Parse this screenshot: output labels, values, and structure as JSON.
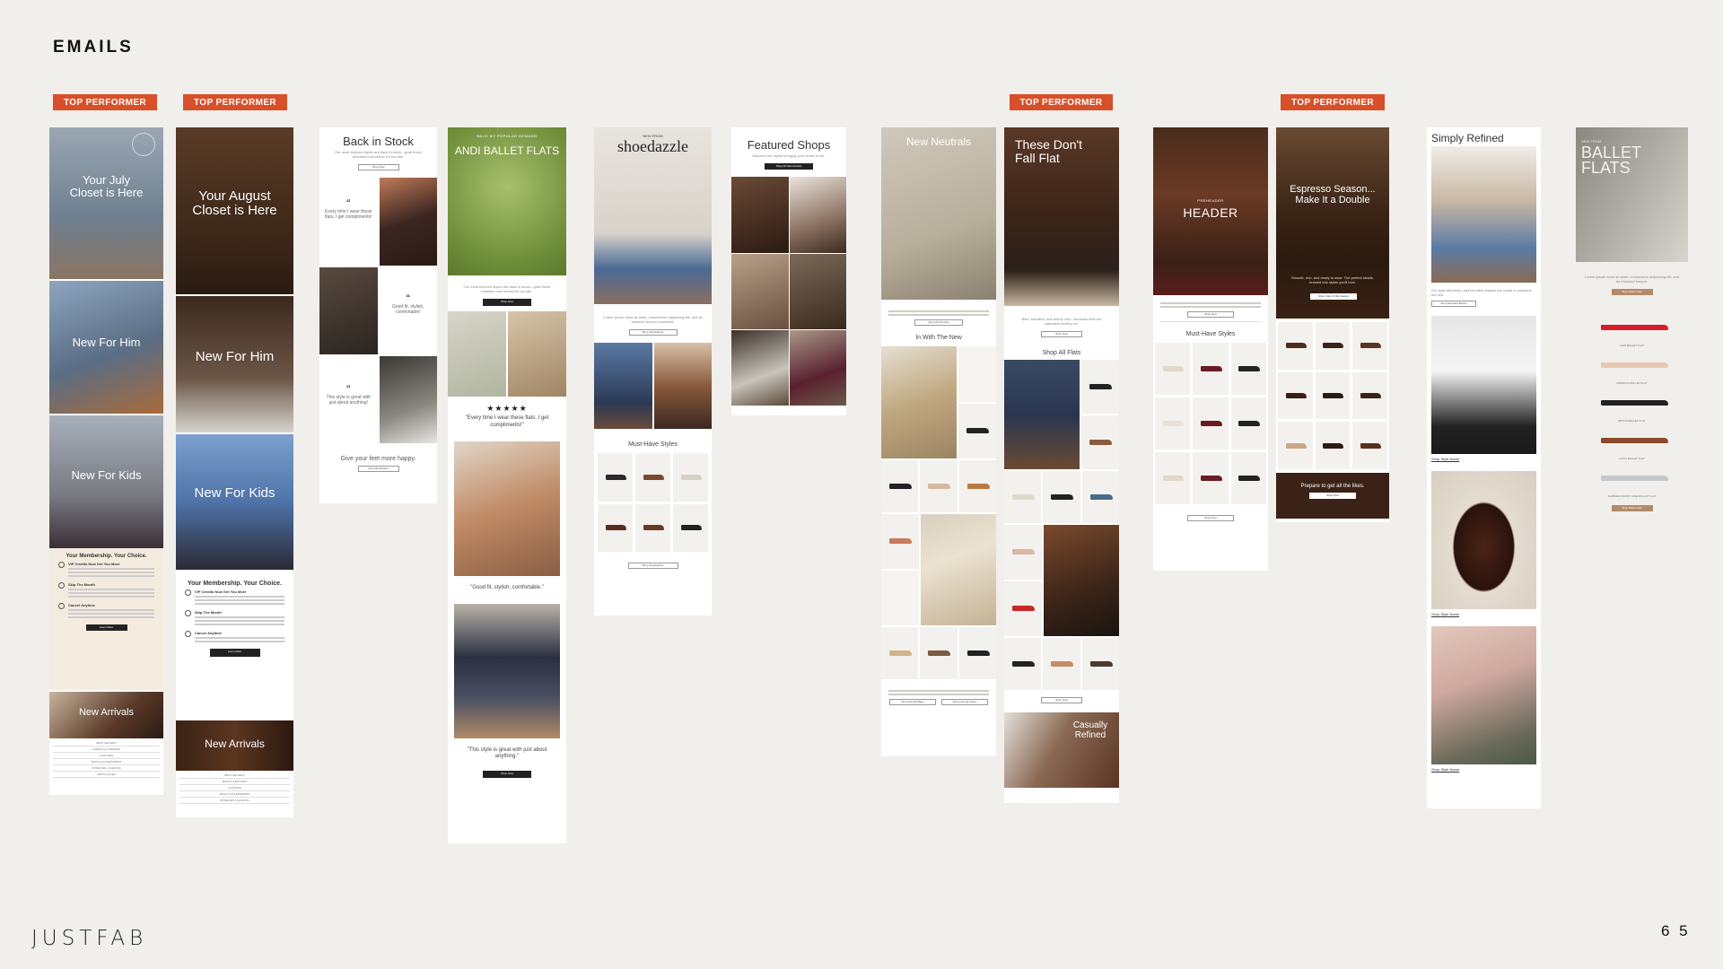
{
  "page": {
    "title": "EMAILS",
    "brand": "JUSTFAB",
    "page_number": "6 5"
  },
  "badges": {
    "label": "TOP PERFORMER"
  },
  "email1": {
    "hero_title": "Your July\nCloset is Here",
    "him": "New For Him",
    "kids": "New For Kids",
    "membership_title": "Your Membership. Your Choice.",
    "steps": [
      "VIP Credits Now Get You More",
      "Skip The Month",
      "Cancel Anytime"
    ],
    "cta": "Learn More",
    "arrivals": "New Arrivals",
    "links": [
      "BEST SELLERS",
      "SANDALS & WEDGES",
      "CLOTHING",
      "BAGS & ACCESSORIES",
      "INTIMATES + SHAPING",
      "MEN'S SHOES"
    ]
  },
  "email2": {
    "hero_title": "Your August\nCloset is Here",
    "him": "New For Him",
    "kids": "New For Kids",
    "membership_title": "Your Membership. Your Choice.",
    "steps": [
      "VIP Credits Now Get You More",
      "Skip The Month",
      "Cancel Anytime"
    ],
    "cta": "Learn More",
    "arrivals": "New Arrivals",
    "links": [
      "BEST SELLERS",
      "BOOTS & BOOTIES",
      "CLOTHING",
      "BAGS & ACCESSORIES",
      "INTIMATES & SHAPING"
    ]
  },
  "email3": {
    "title": "Back in Stock",
    "subtitle": "Our most beloved styles are back in stock—grab these beauties now before it's too late.",
    "cta": "Shop Now",
    "quote1": "Every time I wear these flats, I get compliments!",
    "quote2": "Good fit, stylish, comfortable!",
    "quote3": "This style is great with just about anything!",
    "footer": "Give your feet more happy.",
    "footer_cta": "Shop Bestsellers"
  },
  "email4": {
    "eyebrow": "BACK BY POPULAR DEMAND",
    "title": "ANDI BALLET FLATS",
    "body": "Our most beloved styles are back in stock—grab these beauties now before it's too late.",
    "cta": "Shop Now",
    "stars": "★★★★★",
    "review1": "\"Every time I wear these flats, I get compliments!\"",
    "review2": "\"Good fit, stylish, comfortable.\"",
    "review3": "\"This style is great with just about anything.\""
  },
  "email5": {
    "eyebrow": "NEW FROM",
    "brand": "shoedazzle",
    "body": "Lorem ipsum dolor sit amet, consectetur adipiscing elit, sed do eiusmod tempor incididunt.",
    "cta": "Shop ShoeDazzle",
    "section": "Must-Have Styles"
  },
  "email6": {
    "title": "Featured Shops",
    "subtitle": "Discover the styles bringing your closet to life.",
    "cta": "Shop All New Arrivals"
  },
  "email7": {
    "title": "New Neutrals",
    "cta": "Shop All Neutrals",
    "section": "In With The New",
    "cta2": "Shop Neutral Bags",
    "cta3": "Shop Neutral Shoes"
  },
  "email8": {
    "title": "These Don't\nFall Flat",
    "body": "Bold, elevated, and utterly chic—because flats are statement-worthy too.",
    "cta": "Shop Now",
    "section": "Shop All Flats",
    "cta2": "Shop Now",
    "footer_title": "Casually\nRefined"
  },
  "email9": {
    "eyebrow": "PREHEADER",
    "title": "HEADER",
    "cta": "Shop Now",
    "section": "Must-Have Styles",
    "cta2": "Shop Now"
  },
  "email10": {
    "title": "Espresso Season...\nMake It a Double",
    "body": "Smooth, rich, and ready to wear. The perfect shade, brewed into styles you'll love.",
    "cta": "Shop Color of the Season",
    "banner": "Prepare to get all the likes.",
    "banner_cta": "Shop Now"
  },
  "email11": {
    "title": "Simply Refined",
    "body": "Our light affections, and elevated staples are made to sunshine the rest.",
    "cta": "Shop Elevated Basics",
    "links": [
      "Shop Style Name",
      "Shop Style Name",
      "Shop Style Name"
    ]
  },
  "email12": {
    "eyebrow": "NEW FROM",
    "title": "BALLET\nFLATS",
    "body": "Lorem ipsum dolor sit amet, consectetur adipiscing elit, sed do eiusmod tempor.",
    "cta": "Shop Ballet Flats",
    "products": [
      "ANDI BALLET FLAT",
      "MODESTA BALLET FLAT",
      "BRYNN BALLET FLAT",
      "LUCIA BALLET FLAT",
      "SHIMMER FRONT JANE BALLET FLAT"
    ],
    "cta2": "Shop Ballet Flats"
  },
  "colors": {
    "badge": "#d7502a",
    "background": "#f1efeb",
    "dark_brown": "#4a2a1c",
    "ink": "#111111"
  }
}
